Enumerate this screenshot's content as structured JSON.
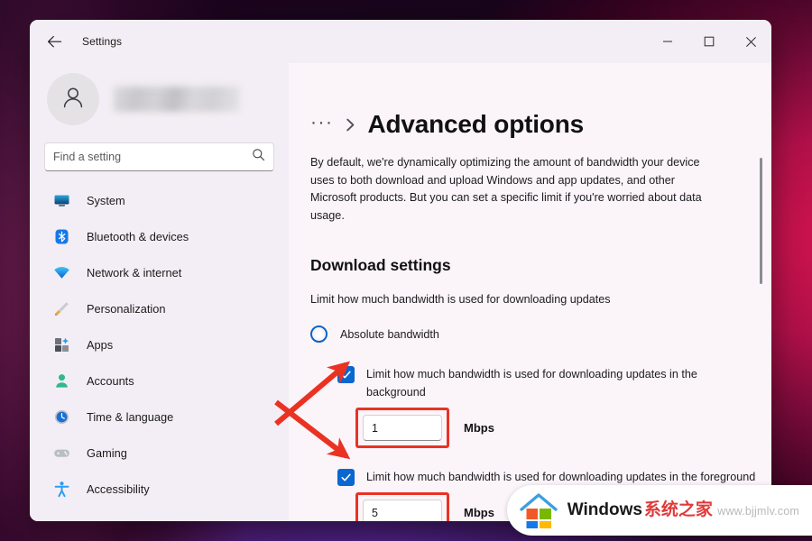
{
  "window": {
    "title": "Settings",
    "back_icon": "back-arrow-icon",
    "minimize_label": "─",
    "maximize_label": "□",
    "close_label": "✕"
  },
  "sidebar": {
    "account_name_redacted": "",
    "search": {
      "placeholder": "Find a setting",
      "value": "",
      "icon": "search-icon"
    },
    "items": [
      {
        "label": "System",
        "icon": "monitor-icon"
      },
      {
        "label": "Bluetooth & devices",
        "icon": "bluetooth-icon"
      },
      {
        "label": "Network & internet",
        "icon": "wifi-icon"
      },
      {
        "label": "Personalization",
        "icon": "paintbrush-icon"
      },
      {
        "label": "Apps",
        "icon": "apps-icon"
      },
      {
        "label": "Accounts",
        "icon": "person-icon"
      },
      {
        "label": "Time & language",
        "icon": "clock-icon"
      },
      {
        "label": "Gaming",
        "icon": "gamepad-icon"
      },
      {
        "label": "Accessibility",
        "icon": "accessibility-icon"
      }
    ]
  },
  "main": {
    "breadcrumb_ellipsis": "···",
    "page_title": "Advanced options",
    "intro": "By default, we're dynamically optimizing the amount of bandwidth your device uses to both download and upload Windows and app updates, and other Microsoft products. But you can set a specific limit if you're worried about data usage.",
    "section_title": "Download settings",
    "section_sub": "Limit how much bandwidth is used for downloading updates",
    "radio": {
      "label": "Absolute bandwidth",
      "selected": true
    },
    "options": [
      {
        "checkbox_label": "Limit how much bandwidth is used for downloading updates in the background",
        "checked": true,
        "value": "1",
        "unit": "Mbps",
        "highlighted": true
      },
      {
        "checkbox_label": "Limit how much bandwidth is used for downloading updates in the foreground",
        "checked": true,
        "value": "5",
        "unit": "Mbps",
        "highlighted": true
      }
    ]
  },
  "watermark": {
    "brand": "Windows",
    "brand_cn": "系统之家",
    "url": "www.bjjmlv.com"
  },
  "colors": {
    "accent_blue": "#0a66d1",
    "annotation_red": "#ea3223",
    "window_bg": "#fbf4f8",
    "sidebar_bg": "#f3eef5"
  }
}
